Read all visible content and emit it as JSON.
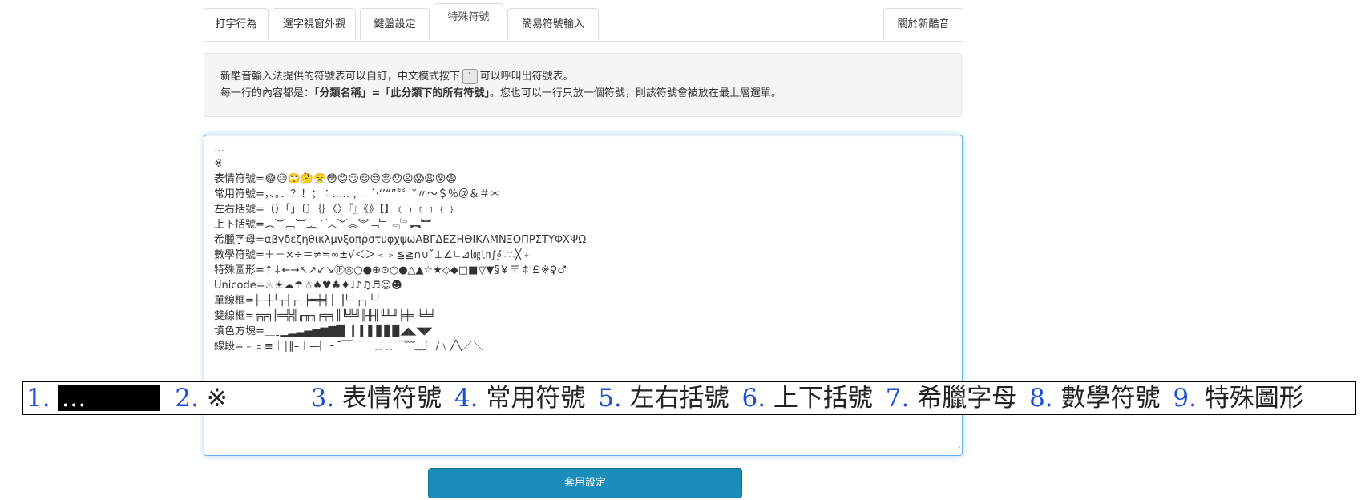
{
  "tabs": [
    {
      "label": "打字行為"
    },
    {
      "label": "選字視窗外觀"
    },
    {
      "label": "鍵盤設定"
    },
    {
      "label": "特殊符號",
      "active": true
    },
    {
      "label": "簡易符號輸入"
    },
    {
      "label": "關於新酷音"
    }
  ],
  "info": {
    "line1_pre": "新酷音輸入法提供的符號表可以自訂，中文模式按下",
    "key": "`",
    "line1_post": "可以呼叫出符號表。",
    "line2_pre": "每一行的內容都是：",
    "line2_bold1": "「分類名稱」=「此分類下的所有符號」",
    "line2_post": "。您也可以一行只放一個符號，則該符號會被放在最上層選單。"
  },
  "editor_lines": [
    "…",
    "※",
    "表情符號=😂😑🙄🤔😤😳😊😏😌😒😔😯😦😱😩😵😨",
    "常用符號=，、。．？！；︰…‥﹐﹒˙·‘’“”〝〞‵′〃～＄％＠＆＃＊",
    "左右括號=（）「」〔〕｛｝〈〉『』《》【】﹙﹚﹝﹞﹛﹜",
    "上下括號=︵︶︹︺︷︸︿﹀︽︾﹁﹂﹃﹄︻︼",
    "希臘字母=αβγδεζηθικλμνξοπρστυφχψωΑΒΓΔΕΖΗΘΙΚΛΜΝΞΟΠΡΣΤΥΦΧΨΩ",
    "數學符號=＋－×÷＝≠≒∞±√＜＞﹤﹥≦≧∩∪ˇ⊥∠∟⊿㏒㏑∫∮∵∴╳﹢",
    "特殊圖形=↑↓←→↖↗↙↘㊣◎○●⊕⊙○●△▲☆★◇◆□■▽▼§￥〒￠￡※♀♂",
    "Unicode=♨☀☁☂☃♠♥♣♦♩♪♫♬☺☻",
    "單線框=├─┼┴┬┤┌┐╞═╪╡│▕└┘╭╮╰╯",
    "雙線框=╔╦╗╠═╬╣╓╥╖╒╤╕║╚╩╝╟╫╢╙╨╜╞╪╡╘╧╛",
    "填色方塊=＿ˍ▁▂▃▄▅▆▇█▏▎▍▌▋▊▉◢◣◥◤",
    "線段=﹣﹦≡｜∣∥–︱—︳╴¯￣﹉﹊﹍﹎﹋﹌﹏︴∕﹨╱╲／＼"
  ],
  "overlay": [
    {
      "num": "1.",
      "text": "…"
    },
    {
      "num": "2.",
      "text": "※"
    },
    {
      "num": "3.",
      "text": "表情符號"
    },
    {
      "num": "4.",
      "text": "常用符號"
    },
    {
      "num": "5.",
      "text": "左右括號"
    },
    {
      "num": "6.",
      "text": "上下括號"
    },
    {
      "num": "7.",
      "text": "希臘字母"
    },
    {
      "num": "8.",
      "text": "數學符號"
    },
    {
      "num": "9.",
      "text": "特殊圖形"
    }
  ],
  "apply_label": "套用設定",
  "colors": {
    "accent": "#1b8dbb",
    "overlay_number": "#1a4fd6",
    "focus_border": "#66afe9"
  }
}
